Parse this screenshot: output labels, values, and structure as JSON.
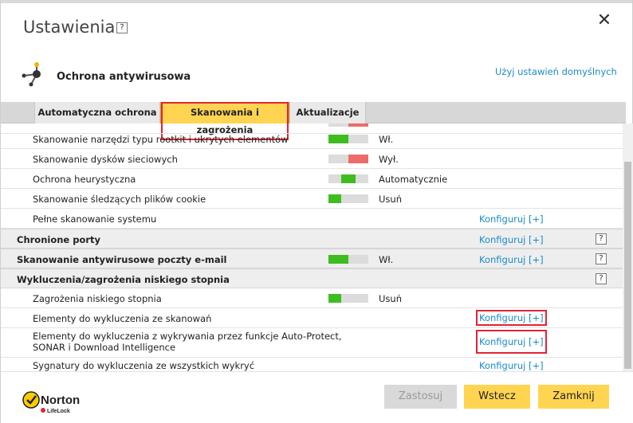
{
  "window": {
    "title": "Ustawienia",
    "help": "?",
    "close": "✕"
  },
  "product": {
    "title": "Ochrona antywirusowa",
    "defaults_link": "Użyj ustawień domyślnych"
  },
  "tabs": [
    {
      "label": "Automatyczna ochrona"
    },
    {
      "label": "Skanowania i zagrożenia"
    },
    {
      "label": "Aktualizacje"
    }
  ],
  "rows": [
    {
      "label": "Skanowanie narzędzi typu rootkit i ukrytych elementów",
      "toggle": "on",
      "status": "Wł."
    },
    {
      "label": "Skanowanie dysków sieciowych",
      "toggle": "off",
      "status": "Wył."
    },
    {
      "label": "Ochrona heurystyczna",
      "toggle": "auto",
      "status": "Automatycznie"
    },
    {
      "label": "Skanowanie śledzących plików cookie",
      "toggle": "remove",
      "status": "Usuń"
    },
    {
      "label": "Pełne skanowanie systemu",
      "configure": "Konfiguruj [+]"
    },
    {
      "label": "Chronione porty",
      "configure": "Konfiguruj [+]",
      "help": "?"
    },
    {
      "label": "Skanowanie antywirusowe poczty e-mail",
      "toggle": "on",
      "status": "Wł.",
      "configure": "Konfiguruj [+]",
      "help": "?"
    },
    {
      "label": "Wykluczenia/zagrożenia niskiego stopnia",
      "help": "?"
    },
    {
      "label": "Zagrożenia niskiego stopnia",
      "toggle": "remove",
      "status": "Usuń"
    },
    {
      "label": "Elementy do wykluczenia ze skanowań",
      "configure": "Konfiguruj [+]"
    },
    {
      "label_line1": "Elementy do wykluczenia z wykrywania przez funkcje Auto-Protect,",
      "label_line2": "SONAR i Download Intelligence",
      "configure": "Konfiguruj [+]"
    },
    {
      "label": "Sygnatury do wykluczenia ze wszystkich wykryć",
      "configure": "Konfiguruj [+]"
    }
  ],
  "footer": {
    "logo_text": "Norton",
    "logo_subtext": "LifeLock",
    "apply": "Zastosuj",
    "back": "Wstecz",
    "close": "Zamknij"
  },
  "colors": {
    "accent_yellow": "#ffd451",
    "link_blue": "#1a8acc",
    "toggle_green": "#3dbd1f",
    "toggle_red": "#ee6b6b",
    "highlight_red": "#e02434"
  }
}
